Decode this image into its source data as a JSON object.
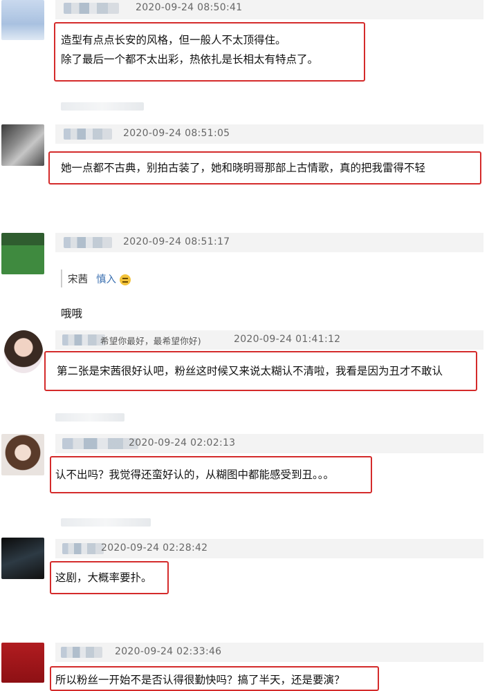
{
  "comments": [
    {
      "timestamp": "2020-09-24 08:50:41",
      "lines": [
        "造型有点点长安的风格，但一般人不太顶得住。",
        "除了最后一个都不太出彩，热依扎是长相太有特点了。"
      ]
    },
    {
      "timestamp": "2020-09-24 08:51:05",
      "lines": [
        "她一点都不古典，别拍古装了，她和晓明哥那部上古情歌，真的把我雷得不轻"
      ]
    },
    {
      "timestamp": "2020-09-24 08:51:17",
      "quote_name": "宋茜",
      "quote_tag": "慎入",
      "text": "哦哦"
    },
    {
      "timestamp": "2020-09-24 01:41:12",
      "name_suffix": "希望你最好，最希望你好)",
      "lines": [
        "第二张是宋茜很好认吧，粉丝这时候又来说太糊认不清啦，我看是因为丑才不敢认"
      ]
    },
    {
      "timestamp": "2020-09-24 02:02:13",
      "lines": [
        "认不出吗？我觉得还蛮好认的，从糊图中都能感受到丑。。。"
      ]
    },
    {
      "timestamp": "2020-09-24 02:28:42",
      "lines": [
        "这剧，大概率要扑。"
      ]
    },
    {
      "timestamp": "2020-09-24 02:33:46",
      "lines": [
        "所以粉丝一开始不是否认得很勤快吗？搞了半天，还是要演？"
      ]
    }
  ],
  "colors": {
    "highlight_border": "#d42a2a",
    "link": "#3a6fb0",
    "meta_bg": "#f3f3f3"
  },
  "icons": {
    "emoji": "grimace-emoji-icon"
  }
}
